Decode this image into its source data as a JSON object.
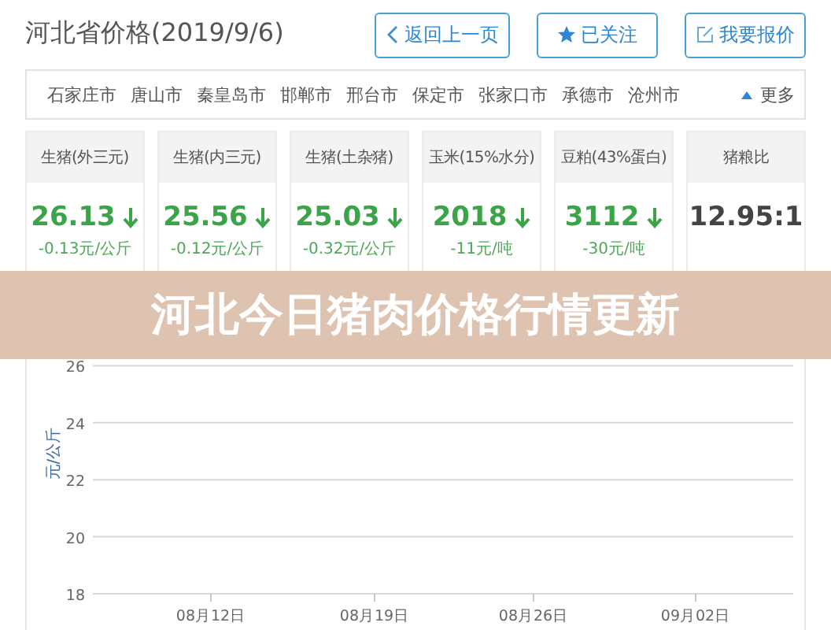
{
  "header": {
    "title": "河北省价格(2019/9/6)",
    "buttons": [
      {
        "kind": "back",
        "label": "返回上一页"
      },
      {
        "kind": "follow",
        "label": "已关注"
      },
      {
        "kind": "quote",
        "label": "我要报价"
      }
    ]
  },
  "cities": {
    "items": [
      "石家庄市",
      "唐山市",
      "秦皇岛市",
      "邯郸市",
      "邢台市",
      "保定市",
      "张家口市",
      "承德市",
      "沧州市"
    ],
    "more": "更多"
  },
  "prices": [
    {
      "name": "生猪(外三元)",
      "value": "26.13",
      "falling": true,
      "change": "-0.13元/公斤"
    },
    {
      "name": "生猪(内三元)",
      "value": "25.56",
      "falling": true,
      "change": "-0.12元/公斤"
    },
    {
      "name": "生猪(土杂猪)",
      "value": "25.03",
      "falling": true,
      "change": "-0.32元/公斤"
    },
    {
      "name": "玉米(15%水分)",
      "value": "2018",
      "falling": true,
      "change": "-11元/吨"
    },
    {
      "name": "豆粕(43%蛋白)",
      "value": "3112",
      "falling": true,
      "change": "-30元/吨"
    },
    {
      "name": "猪粮比",
      "value": "12.95:1",
      "falling": false
    }
  ],
  "banner": "河北今日猪肉价格行情更新",
  "chart": {
    "chart_data": {
      "type": "line",
      "ylabel": "元/公斤",
      "ylim": [
        18,
        26
      ],
      "yticks": [
        18,
        20,
        22,
        24,
        26
      ],
      "grid": true,
      "categories": [
        "08月12日",
        "08月19日",
        "08月26日",
        "09月02日"
      ]
    }
  }
}
